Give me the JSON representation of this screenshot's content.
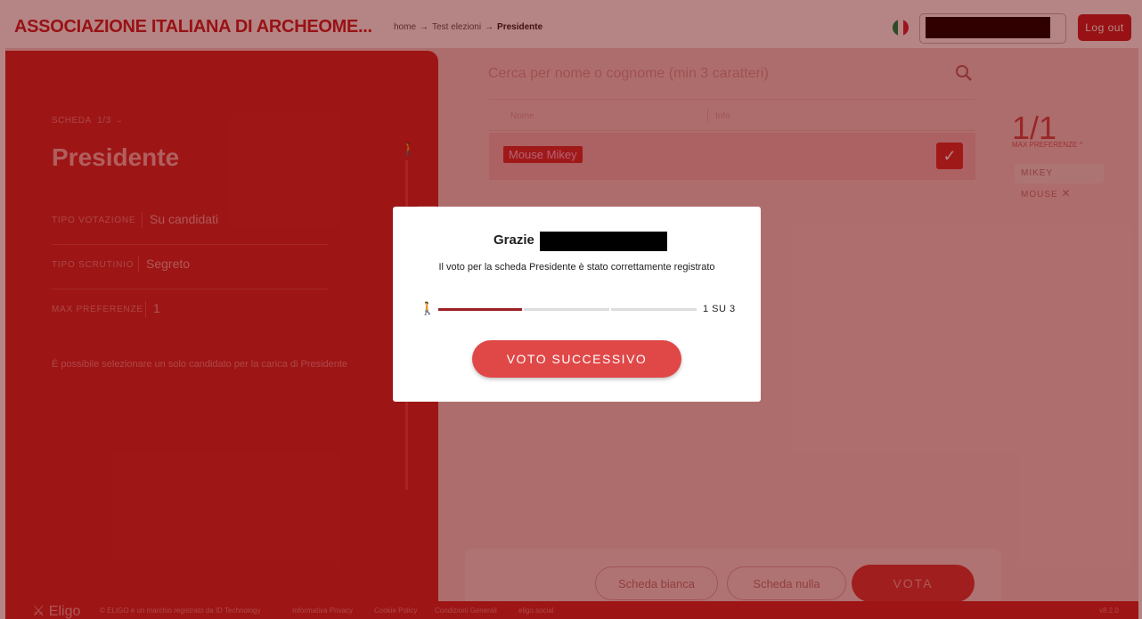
{
  "header": {
    "org_name": "ASSOCIAZIONE ITALIANA DI ARCHEOME...",
    "breadcrumb": [
      "home",
      "Test elezioni",
      "Presidente"
    ],
    "logout_label": "Log out"
  },
  "ballot": {
    "scheda_label": "SCHEDA",
    "scheda_progress": "1/3",
    "title": "Presidente",
    "meta": [
      {
        "label": "TIPO VOTAZIONE",
        "value": "Su candidati"
      },
      {
        "label": "TIPO SCRUTINIO",
        "value": "Segreto"
      },
      {
        "label": "MAX PREFERENZE",
        "value": "1"
      }
    ],
    "hint": "È possibile selezionare un solo candidato per la carica di Presidente",
    "step_number": "1"
  },
  "search": {
    "placeholder": "Cerca per nome o cognome (min 3 caratteri)"
  },
  "table": {
    "columns": [
      "Nome",
      "Info"
    ],
    "rows": [
      {
        "name": "Mouse Mikey",
        "selected": true
      }
    ]
  },
  "preferences": {
    "counter": "1/1",
    "label": "MAX PREFERENZE",
    "selected_chip": "MIKEY MOUSE"
  },
  "actions": {
    "blank_label": "Scheda bianca",
    "null_label": "Scheda nulla",
    "vote_label": "VOTA"
  },
  "footer": {
    "logo": "Eligo",
    "links": [
      "© ELIGO è un marchio registrato da ID Technology",
      "Informativa Privacy",
      "Cookie Policy",
      "Condizioni Generali",
      "eligo.social"
    ],
    "version": "v8.2.0"
  },
  "modal": {
    "greeting": "Grazie",
    "message": "Il voto per la scheda Presidente è stato correttamente registrato",
    "progress_text": "1 SU 3",
    "progress_fraction": 0.333,
    "next_label": "VOTO SUCCESSIVO"
  },
  "colors": {
    "brand_red": "#c8242a",
    "panel_red": "#d42a2a",
    "button_red": "#e04848"
  },
  "icons": [
    "walk-icon",
    "search-icon",
    "check-icon",
    "close-icon",
    "arrow-right-icon",
    "chevron-up-icon",
    "italy-flag-icon",
    "eligo-logo-icon"
  ]
}
